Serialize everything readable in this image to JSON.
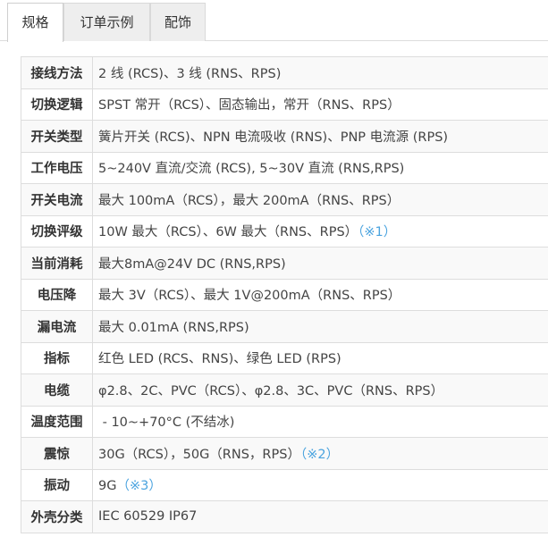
{
  "tabs": [
    {
      "label": "规格",
      "active": true
    },
    {
      "label": "订单示例",
      "active": false
    },
    {
      "label": "配饰",
      "active": false
    }
  ],
  "colors": {
    "note_link": "#4aa3df",
    "border": "#dddddd",
    "row_alt": "#f9f9f9"
  },
  "specs": [
    {
      "label": "接线方法",
      "value": "2 线 (RCS)、3 线 (RNS、RPS)",
      "note": ""
    },
    {
      "label": "切换逻辑",
      "value": "SPST 常开（RCS）、固态输出，常开（RNS、RPS）",
      "note": ""
    },
    {
      "label": "开关类型",
      "value": "簧片开关 (RCS)、NPN 电流吸收 (RNS)、PNP 电流源 (RPS)",
      "note": ""
    },
    {
      "label": "工作电压",
      "value": "5~240V 直流/交流 (RCS), 5~30V 直流 (RNS,RPS)",
      "note": ""
    },
    {
      "label": "开关电流",
      "value": "最大 100mA（RCS），最大 200mA（RNS、RPS）",
      "note": ""
    },
    {
      "label": "切换评级",
      "value": "10W 最大（RCS）、6W 最大（RNS、RPS）",
      "note": "（※1）"
    },
    {
      "label": "当前消耗",
      "value": "最大8mA@24V DC (RNS,RPS)",
      "note": ""
    },
    {
      "label": "电压降",
      "value": "最大 3V（RCS）、最大 1V@200mA（RNS、RPS）",
      "note": ""
    },
    {
      "label": "漏电流",
      "value": "最大 0.01mA (RNS,RPS)",
      "note": ""
    },
    {
      "label": "指标",
      "value": "红色 LED (RCS、RNS)、绿色 LED (RPS)",
      "note": ""
    },
    {
      "label": "电缆",
      "value": "φ2.8、2C、PVC（RCS）、φ2.8、3C、PVC（RNS、RPS）",
      "note": ""
    },
    {
      "label": "温度范围",
      "value": " - 10~+70°C (不结冰)",
      "note": ""
    },
    {
      "label": "震惊",
      "value": "30G（RCS），50G（RNS，RPS）",
      "note": "（※2）"
    },
    {
      "label": "振动",
      "value": "9G",
      "note": "（※3）"
    },
    {
      "label": "外壳分类",
      "value": "IEC 60529 IP67",
      "note": ""
    }
  ]
}
